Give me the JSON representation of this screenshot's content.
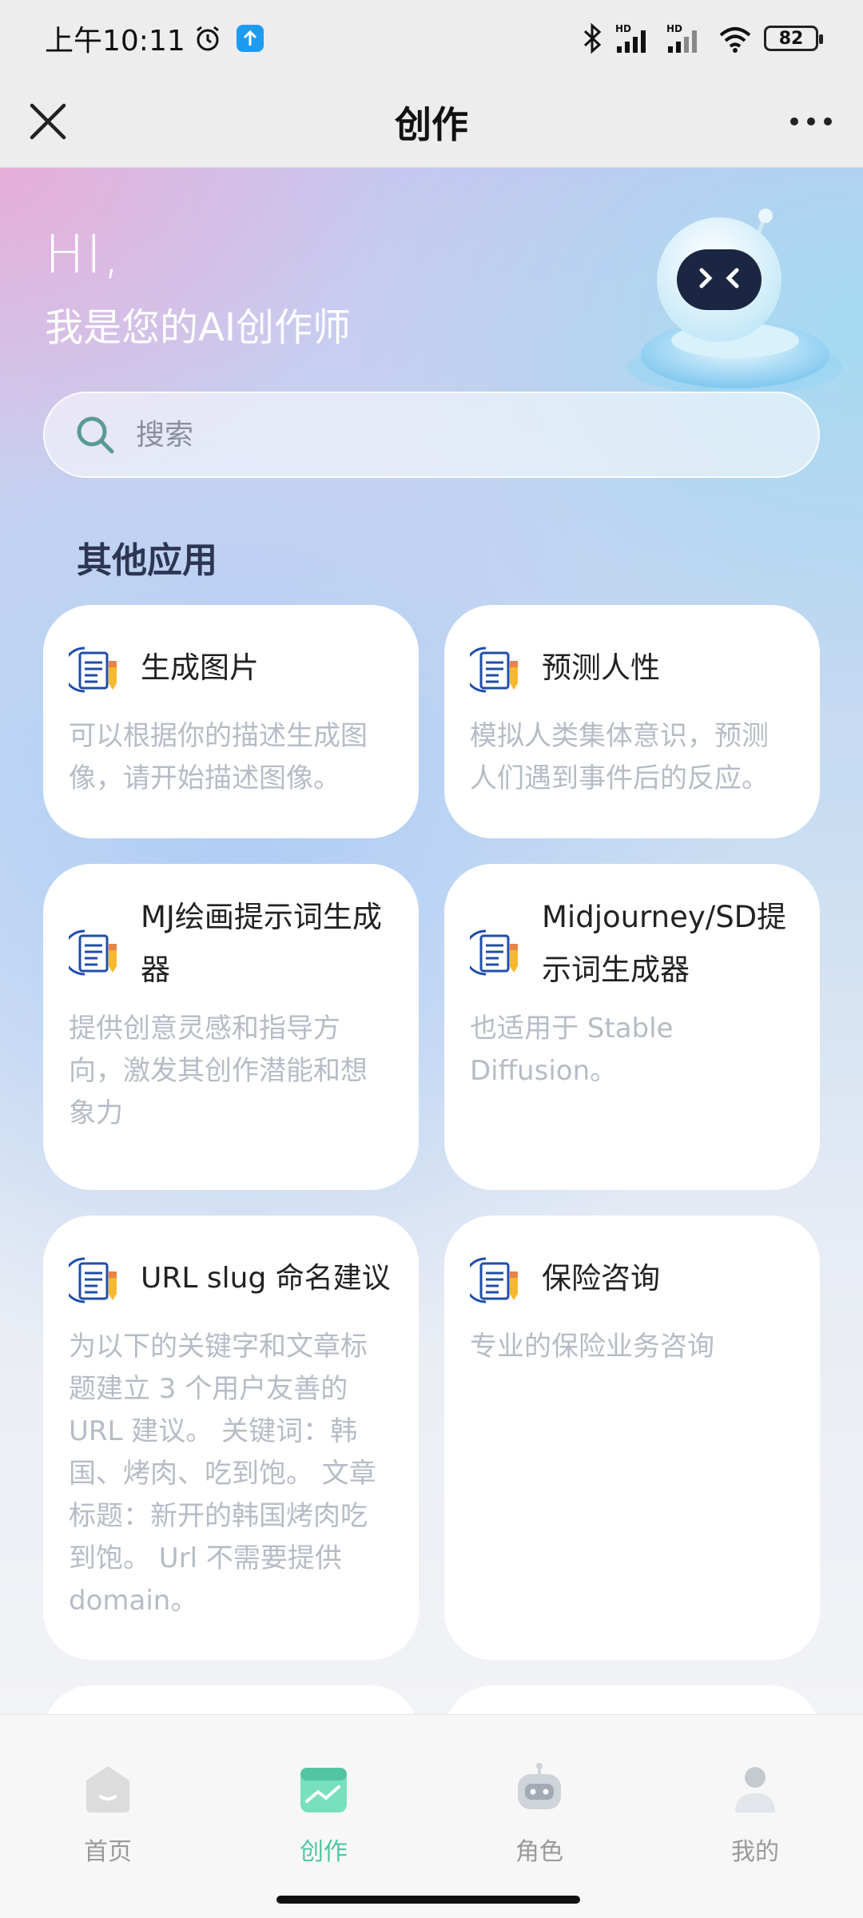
{
  "status_bar": {
    "time": "上午10:11",
    "battery": "82",
    "icons": [
      "alarm-icon",
      "upload-icon",
      "bluetooth-icon",
      "signal-hd-icon",
      "signal-hd-icon",
      "wifi-icon",
      "battery-icon"
    ]
  },
  "nav": {
    "title": "创作",
    "close_icon": "close-icon",
    "more_icon": "more-icon"
  },
  "header": {
    "greeting": "HI,",
    "subtitle": "我是您的AI创作师"
  },
  "search": {
    "placeholder": "搜索"
  },
  "section": {
    "title": "其他应用"
  },
  "cards": [
    {
      "title": "生成图片",
      "desc": "可以根据你的描述生成图像，请开始描述图像。"
    },
    {
      "title": "预测人性",
      "desc": "模拟人类集体意识，预测人们遇到事件后的反应。"
    },
    {
      "title": "MJ绘画提示词生成器",
      "desc": "提供创意灵感和指导方向，激发其创作潜能和想象力"
    },
    {
      "title": "Midjourney/SD提示词生成器",
      "desc": "也适用于 Stable Diffusion。"
    },
    {
      "title": "URL slug 命名建议",
      "desc": "为以下的关键字和文章标题建立 3 个用户友善的 URL 建议。 关键词：韩国、烤肉、吃到饱。 文章标题：新开的韩国烤肉吃到饱。 Url 不需要提供 domain。"
    },
    {
      "title": "保险咨询",
      "desc": "专业的保险业务咨询"
    }
  ],
  "tabs": [
    {
      "label": "首页",
      "icon": "home-icon",
      "active": false
    },
    {
      "label": "创作",
      "icon": "create-icon",
      "active": true
    },
    {
      "label": "角色",
      "icon": "robot-icon",
      "active": false
    },
    {
      "label": "我的",
      "icon": "user-icon",
      "active": false
    }
  ],
  "colors": {
    "accent": "#52c5a3",
    "card_desc": "#b6bcc6",
    "section_title": "#2d3552"
  }
}
